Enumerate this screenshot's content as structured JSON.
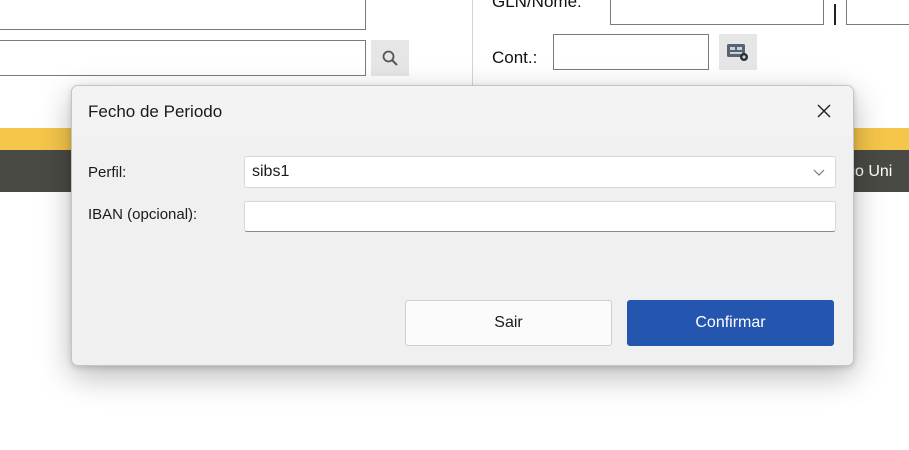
{
  "background": {
    "gln_label": "GLN/Nome:",
    "cont_label": "Cont.:",
    "dark_bar_text": "ço Uni",
    "icons": {
      "search": "magnifier-icon",
      "lookup": "card-lookup-icon"
    }
  },
  "dialog": {
    "title": "Fecho de Periodo",
    "close_icon": "close-icon",
    "perfil": {
      "label": "Perfil:",
      "selected": "sibs1"
    },
    "iban": {
      "label": "IBAN (opcional):",
      "value": ""
    },
    "buttons": {
      "cancel": "Sair",
      "confirm": "Confirmar"
    }
  },
  "colors": {
    "accent": "#2456b0",
    "yellow_bar": "#f5c64a",
    "dark_bar": "#4a4a45",
    "dialog_bg": "#f0f0f0"
  }
}
